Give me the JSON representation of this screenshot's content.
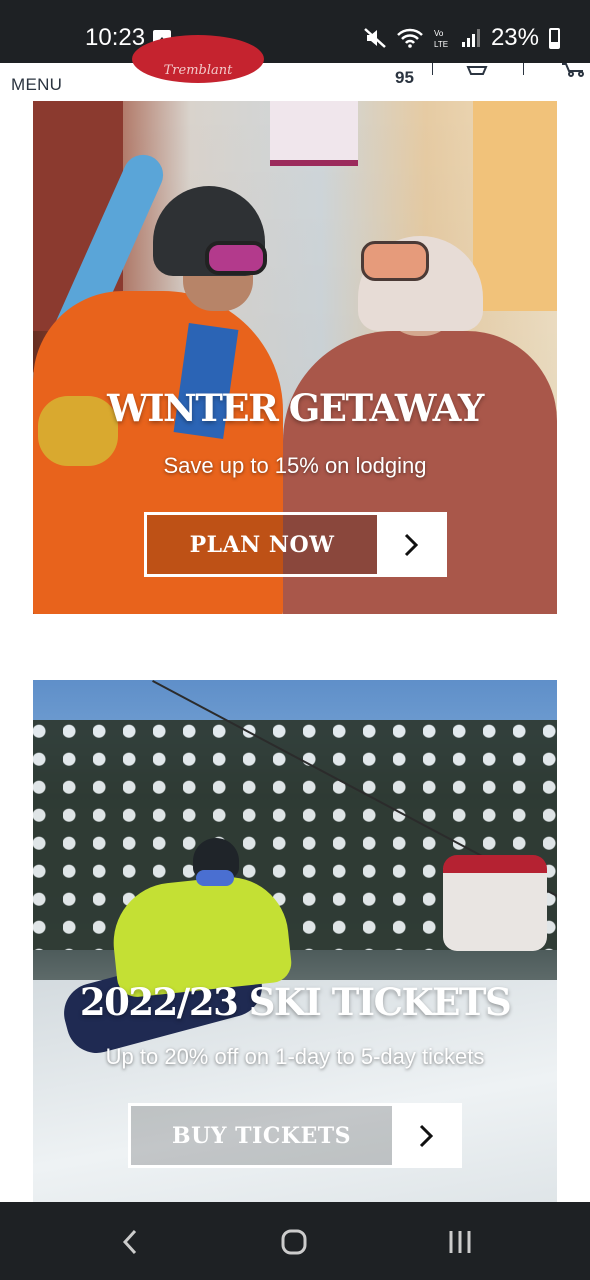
{
  "status_bar": {
    "time": "10:23",
    "battery": "23%",
    "icons": [
      "image-icon",
      "mute-icon",
      "wifi-icon",
      "volte-icon",
      "signal-icon",
      "battery-icon"
    ]
  },
  "header": {
    "menu_label": "MENU",
    "temperature": "95",
    "logo_text": "Tremblant"
  },
  "promos": [
    {
      "title": "WINTER GETAWAY",
      "subtitle": "Save up to 15% on lodging",
      "cta_label": "PLAN NOW"
    },
    {
      "title": "2022/23 SKI TICKETS",
      "subtitle": "Up to 20% off on 1-day to 5-day tickets",
      "cta_label": "BUY TICKETS"
    }
  ],
  "colors": {
    "brand_red": "#c5232f",
    "status_bar": "#1e2124",
    "header_text": "#2b3440"
  },
  "nav": {
    "icons": [
      "back-icon",
      "home-icon",
      "recents-icon"
    ]
  }
}
